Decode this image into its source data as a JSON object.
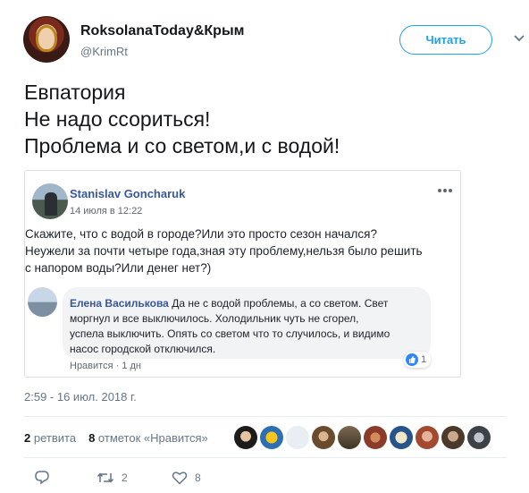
{
  "author": {
    "name": "RoksolanaToday&Крым",
    "handle": "@KrimRt",
    "avatar_icon": "profile-avatar"
  },
  "follow_button_label": "Читать",
  "tweet_lines": [
    "Евпатория",
    "Не надо ссориться!",
    "Проблема и со светом,и с водой!"
  ],
  "embed": {
    "author": "Stanislav Goncharuk",
    "date": "14 июля в 12:22",
    "text_lines": [
      "Скажите, что с водой в городе?Или это просто сезон начался?",
      "Неужели за почти четыре года,зная эту проблему,нельзя было решить",
      "с напором воды?Или денег нет?)"
    ],
    "comment": {
      "author": "Елена Василькова",
      "text_first": "Да не с водой проблемы, а со светом. Свет",
      "text_lines": [
        "моргнул и все выключилось. Холодильник чуть не сгорел,",
        "успела выключить. Опять со светом что то случилось, и видимо",
        "насос городской отключился."
      ],
      "actions": "Нравится · 1 дн",
      "reaction_count": "1",
      "reaction_icon": "like-icon"
    }
  },
  "timestamp": "2:59 - 16 июл. 2018 г.",
  "stats": {
    "retweets_count": "2",
    "retweets_label": "ретвита",
    "likes_count": "8",
    "likes_label": "отметок «Нравится»"
  },
  "likers_count": 10,
  "actions": {
    "reply_icon": "reply-icon",
    "retweet_icon": "retweet-icon",
    "retweet_count": "2",
    "like_icon": "heart-icon",
    "like_count": "8"
  },
  "colors": {
    "accent": "#1da1f2",
    "fb_link": "#385898",
    "muted": "#657786"
  }
}
